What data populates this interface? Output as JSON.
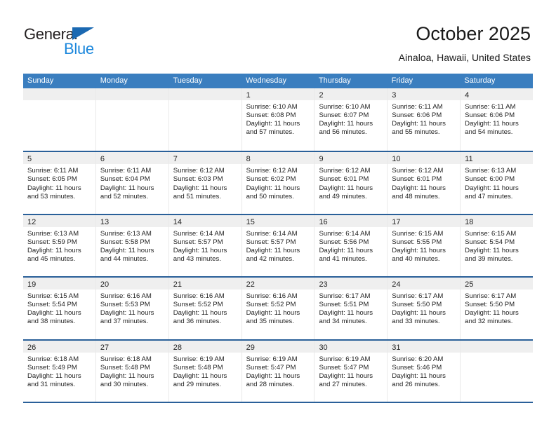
{
  "brand": {
    "name_top": "General",
    "name_bottom": "Blue",
    "triangle_icon": "triangle-icon",
    "color_dark": "#231f20",
    "color_blue": "#1b87dc",
    "color_triangle": "#1b69b2"
  },
  "header": {
    "title": "October 2025",
    "subtitle": "Ainaloa, Hawaii, United States"
  },
  "theme": {
    "header_bg": "#3a7ebf",
    "row_divider": "#2a6099",
    "daynum_band": "#efefef",
    "text": "#232323"
  },
  "weekdays": [
    "Sunday",
    "Monday",
    "Tuesday",
    "Wednesday",
    "Thursday",
    "Friday",
    "Saturday"
  ],
  "labels": {
    "sunrise_prefix": "Sunrise:",
    "sunset_prefix": "Sunset:",
    "daylight_prefix": "Daylight:"
  },
  "weeks": [
    [
      {
        "day": "",
        "empty": true
      },
      {
        "day": "",
        "empty": true
      },
      {
        "day": "",
        "empty": true
      },
      {
        "day": "1",
        "sunrise": "Sunrise: 6:10 AM",
        "sunset": "Sunset: 6:08 PM",
        "daylight_l1": "Daylight: 11 hours",
        "daylight_l2": "and 57 minutes."
      },
      {
        "day": "2",
        "sunrise": "Sunrise: 6:10 AM",
        "sunset": "Sunset: 6:07 PM",
        "daylight_l1": "Daylight: 11 hours",
        "daylight_l2": "and 56 minutes."
      },
      {
        "day": "3",
        "sunrise": "Sunrise: 6:11 AM",
        "sunset": "Sunset: 6:06 PM",
        "daylight_l1": "Daylight: 11 hours",
        "daylight_l2": "and 55 minutes."
      },
      {
        "day": "4",
        "sunrise": "Sunrise: 6:11 AM",
        "sunset": "Sunset: 6:06 PM",
        "daylight_l1": "Daylight: 11 hours",
        "daylight_l2": "and 54 minutes."
      }
    ],
    [
      {
        "day": "5",
        "sunrise": "Sunrise: 6:11 AM",
        "sunset": "Sunset: 6:05 PM",
        "daylight_l1": "Daylight: 11 hours",
        "daylight_l2": "and 53 minutes."
      },
      {
        "day": "6",
        "sunrise": "Sunrise: 6:11 AM",
        "sunset": "Sunset: 6:04 PM",
        "daylight_l1": "Daylight: 11 hours",
        "daylight_l2": "and 52 minutes."
      },
      {
        "day": "7",
        "sunrise": "Sunrise: 6:12 AM",
        "sunset": "Sunset: 6:03 PM",
        "daylight_l1": "Daylight: 11 hours",
        "daylight_l2": "and 51 minutes."
      },
      {
        "day": "8",
        "sunrise": "Sunrise: 6:12 AM",
        "sunset": "Sunset: 6:02 PM",
        "daylight_l1": "Daylight: 11 hours",
        "daylight_l2": "and 50 minutes."
      },
      {
        "day": "9",
        "sunrise": "Sunrise: 6:12 AM",
        "sunset": "Sunset: 6:01 PM",
        "daylight_l1": "Daylight: 11 hours",
        "daylight_l2": "and 49 minutes."
      },
      {
        "day": "10",
        "sunrise": "Sunrise: 6:12 AM",
        "sunset": "Sunset: 6:01 PM",
        "daylight_l1": "Daylight: 11 hours",
        "daylight_l2": "and 48 minutes."
      },
      {
        "day": "11",
        "sunrise": "Sunrise: 6:13 AM",
        "sunset": "Sunset: 6:00 PM",
        "daylight_l1": "Daylight: 11 hours",
        "daylight_l2": "and 47 minutes."
      }
    ],
    [
      {
        "day": "12",
        "sunrise": "Sunrise: 6:13 AM",
        "sunset": "Sunset: 5:59 PM",
        "daylight_l1": "Daylight: 11 hours",
        "daylight_l2": "and 45 minutes."
      },
      {
        "day": "13",
        "sunrise": "Sunrise: 6:13 AM",
        "sunset": "Sunset: 5:58 PM",
        "daylight_l1": "Daylight: 11 hours",
        "daylight_l2": "and 44 minutes."
      },
      {
        "day": "14",
        "sunrise": "Sunrise: 6:14 AM",
        "sunset": "Sunset: 5:57 PM",
        "daylight_l1": "Daylight: 11 hours",
        "daylight_l2": "and 43 minutes."
      },
      {
        "day": "15",
        "sunrise": "Sunrise: 6:14 AM",
        "sunset": "Sunset: 5:57 PM",
        "daylight_l1": "Daylight: 11 hours",
        "daylight_l2": "and 42 minutes."
      },
      {
        "day": "16",
        "sunrise": "Sunrise: 6:14 AM",
        "sunset": "Sunset: 5:56 PM",
        "daylight_l1": "Daylight: 11 hours",
        "daylight_l2": "and 41 minutes."
      },
      {
        "day": "17",
        "sunrise": "Sunrise: 6:15 AM",
        "sunset": "Sunset: 5:55 PM",
        "daylight_l1": "Daylight: 11 hours",
        "daylight_l2": "and 40 minutes."
      },
      {
        "day": "18",
        "sunrise": "Sunrise: 6:15 AM",
        "sunset": "Sunset: 5:54 PM",
        "daylight_l1": "Daylight: 11 hours",
        "daylight_l2": "and 39 minutes."
      }
    ],
    [
      {
        "day": "19",
        "sunrise": "Sunrise: 6:15 AM",
        "sunset": "Sunset: 5:54 PM",
        "daylight_l1": "Daylight: 11 hours",
        "daylight_l2": "and 38 minutes."
      },
      {
        "day": "20",
        "sunrise": "Sunrise: 6:16 AM",
        "sunset": "Sunset: 5:53 PM",
        "daylight_l1": "Daylight: 11 hours",
        "daylight_l2": "and 37 minutes."
      },
      {
        "day": "21",
        "sunrise": "Sunrise: 6:16 AM",
        "sunset": "Sunset: 5:52 PM",
        "daylight_l1": "Daylight: 11 hours",
        "daylight_l2": "and 36 minutes."
      },
      {
        "day": "22",
        "sunrise": "Sunrise: 6:16 AM",
        "sunset": "Sunset: 5:52 PM",
        "daylight_l1": "Daylight: 11 hours",
        "daylight_l2": "and 35 minutes."
      },
      {
        "day": "23",
        "sunrise": "Sunrise: 6:17 AM",
        "sunset": "Sunset: 5:51 PM",
        "daylight_l1": "Daylight: 11 hours",
        "daylight_l2": "and 34 minutes."
      },
      {
        "day": "24",
        "sunrise": "Sunrise: 6:17 AM",
        "sunset": "Sunset: 5:50 PM",
        "daylight_l1": "Daylight: 11 hours",
        "daylight_l2": "and 33 minutes."
      },
      {
        "day": "25",
        "sunrise": "Sunrise: 6:17 AM",
        "sunset": "Sunset: 5:50 PM",
        "daylight_l1": "Daylight: 11 hours",
        "daylight_l2": "and 32 minutes."
      }
    ],
    [
      {
        "day": "26",
        "sunrise": "Sunrise: 6:18 AM",
        "sunset": "Sunset: 5:49 PM",
        "daylight_l1": "Daylight: 11 hours",
        "daylight_l2": "and 31 minutes."
      },
      {
        "day": "27",
        "sunrise": "Sunrise: 6:18 AM",
        "sunset": "Sunset: 5:48 PM",
        "daylight_l1": "Daylight: 11 hours",
        "daylight_l2": "and 30 minutes."
      },
      {
        "day": "28",
        "sunrise": "Sunrise: 6:19 AM",
        "sunset": "Sunset: 5:48 PM",
        "daylight_l1": "Daylight: 11 hours",
        "daylight_l2": "and 29 minutes."
      },
      {
        "day": "29",
        "sunrise": "Sunrise: 6:19 AM",
        "sunset": "Sunset: 5:47 PM",
        "daylight_l1": "Daylight: 11 hours",
        "daylight_l2": "and 28 minutes."
      },
      {
        "day": "30",
        "sunrise": "Sunrise: 6:19 AM",
        "sunset": "Sunset: 5:47 PM",
        "daylight_l1": "Daylight: 11 hours",
        "daylight_l2": "and 27 minutes."
      },
      {
        "day": "31",
        "sunrise": "Sunrise: 6:20 AM",
        "sunset": "Sunset: 5:46 PM",
        "daylight_l1": "Daylight: 11 hours",
        "daylight_l2": "and 26 minutes."
      },
      {
        "day": "",
        "empty": true
      }
    ]
  ]
}
